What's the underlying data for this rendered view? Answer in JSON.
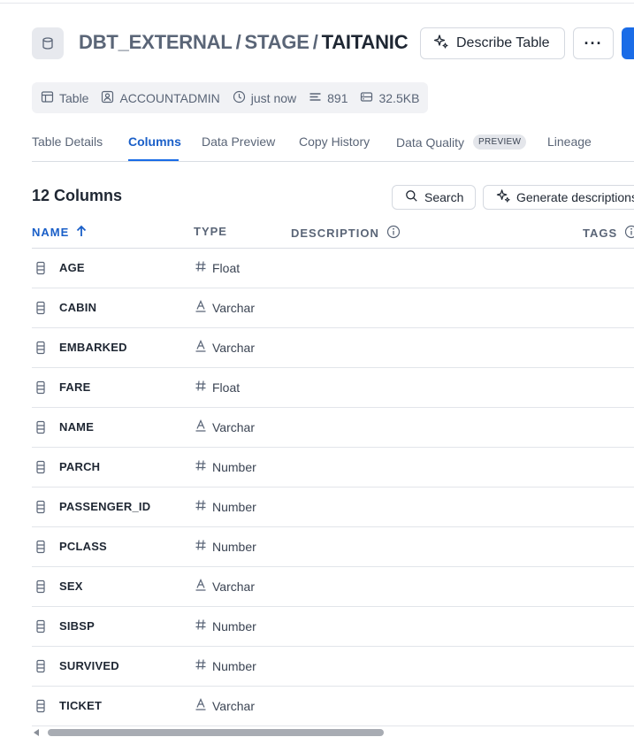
{
  "header": {
    "crumb_db": "DBT_EXTERNAL",
    "crumb_schema": "STAGE",
    "sep": "/",
    "crumb_table": "TAITANIC",
    "describe_label": "Describe Table",
    "more_label": "···"
  },
  "meta": {
    "kind": "Table",
    "owner": "ACCOUNTADMIN",
    "updated": "just now",
    "rows": "891",
    "size": "32.5KB"
  },
  "tabs": {
    "details": "Table Details",
    "columns": "Columns",
    "preview": "Data Preview",
    "copy_history": "Copy History",
    "quality": "Data Quality",
    "quality_badge": "PREVIEW",
    "lineage": "Lineage"
  },
  "toolbar": {
    "count_label": "12 Columns",
    "search_label": "Search",
    "generate_label": "Generate descriptions"
  },
  "table": {
    "headers": {
      "name": "NAME",
      "type": "TYPE",
      "description": "DESCRIPTION",
      "tags": "TAGS"
    },
    "rows": [
      {
        "name": "AGE",
        "type": "Float",
        "kind": "num"
      },
      {
        "name": "CABIN",
        "type": "Varchar",
        "kind": "text"
      },
      {
        "name": "EMBARKED",
        "type": "Varchar",
        "kind": "text"
      },
      {
        "name": "FARE",
        "type": "Float",
        "kind": "num"
      },
      {
        "name": "NAME",
        "type": "Varchar",
        "kind": "text"
      },
      {
        "name": "PARCH",
        "type": "Number",
        "kind": "num"
      },
      {
        "name": "PASSENGER_ID",
        "type": "Number",
        "kind": "num"
      },
      {
        "name": "PCLASS",
        "type": "Number",
        "kind": "num"
      },
      {
        "name": "SEX",
        "type": "Varchar",
        "kind": "text"
      },
      {
        "name": "SIBSP",
        "type": "Number",
        "kind": "num"
      },
      {
        "name": "SURVIVED",
        "type": "Number",
        "kind": "num"
      },
      {
        "name": "TICKET",
        "type": "Varchar",
        "kind": "text"
      }
    ]
  },
  "colors": {
    "accent": "#1a6ce7",
    "accent_text": "#1a5fc8",
    "muted": "#5a6577"
  }
}
